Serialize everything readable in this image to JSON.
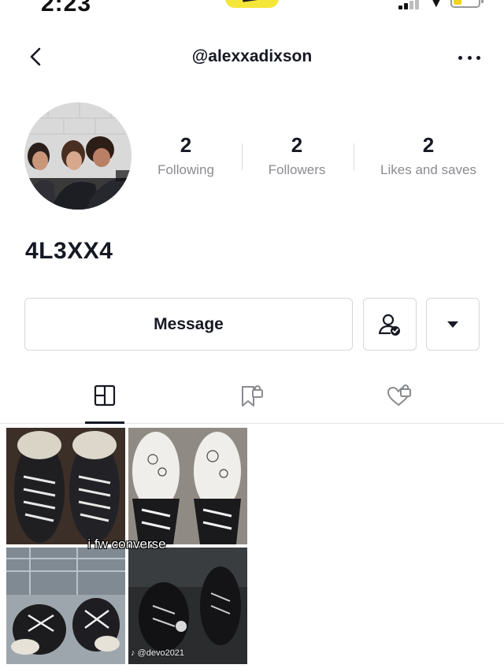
{
  "status_bar": {
    "time": "2:23"
  },
  "header": {
    "username": "@alexxadixson"
  },
  "profile": {
    "display_name": "4L3XX4"
  },
  "stats": [
    {
      "value": "2",
      "label": "Following"
    },
    {
      "value": "2",
      "label": "Followers"
    },
    {
      "value": "2",
      "label": "Likes and saves"
    }
  ],
  "actions": {
    "message_label": "Message"
  },
  "tabs": [
    {
      "name": "videos",
      "icon": "grid-icon",
      "active": true
    },
    {
      "name": "favorites",
      "icon": "bookmark-lock-icon",
      "active": false
    },
    {
      "name": "liked",
      "icon": "heart-lock-icon",
      "active": false
    }
  ],
  "videos": [
    {
      "caption": "i fw converse",
      "watermark": "♪ @devo2021"
    }
  ],
  "colors": {
    "text_primary": "#161823",
    "text_secondary": "#8a8b91",
    "border": "#d6d6d9",
    "battery": "#f2d41e"
  }
}
